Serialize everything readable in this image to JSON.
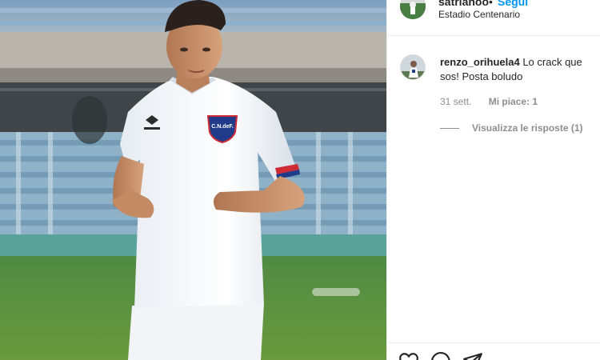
{
  "post": {
    "username": "satrianoo",
    "separator": "•",
    "follow_label": "Segui",
    "location": "Estadio Centenario"
  },
  "comment": {
    "username": "renzo_orihuela4",
    "text": "Lo crack que sos! Posta boludo",
    "time": "31 sett.",
    "likes": "Mi piace: 1",
    "replies": "Visualizza le risposte (1)"
  },
  "photo": {
    "crest_text": "C.N.deF."
  },
  "actions": {
    "like_icon": "heart-icon",
    "comment_icon": "comment-icon",
    "share_icon": "paper-plane-icon"
  },
  "colors": {
    "accent": "#0095f6",
    "secondary_text": "#8e8e8e",
    "border": "#efefef"
  }
}
